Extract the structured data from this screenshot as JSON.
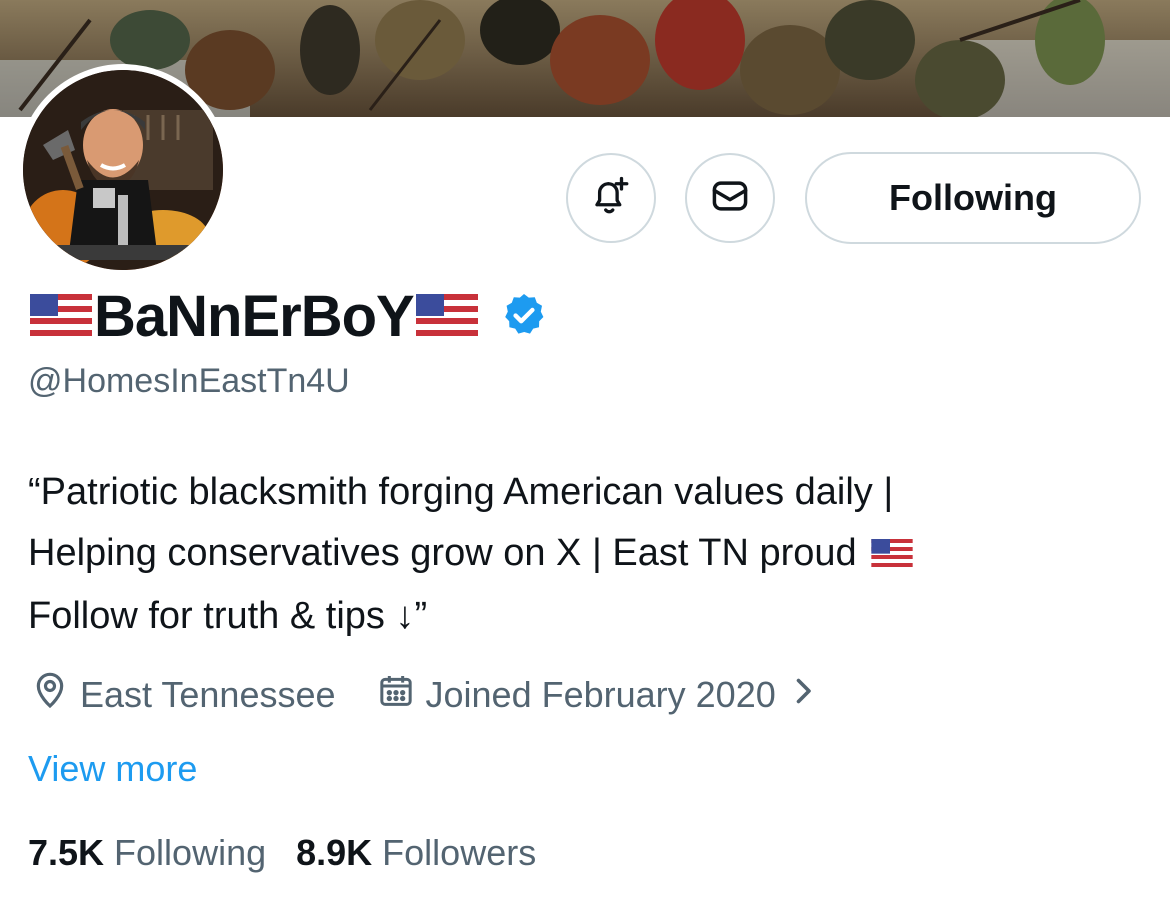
{
  "profile": {
    "display_name": "BaNnErBoY",
    "handle": "@HomesInEastTn4U",
    "verified_icon": "verified-badge-icon",
    "flag_icon": "us-flag-icon"
  },
  "actions": {
    "notify_icon": "bell-plus-icon",
    "message_icon": "envelope-icon",
    "follow_label": "Following"
  },
  "bio": {
    "line1": "“Patriotic blacksmith forging American values daily |",
    "line2": "Helping conservatives grow on X | East TN proud",
    "line3": "Follow for truth & tips ↓”"
  },
  "meta": {
    "location": "East Tennessee",
    "joined": "Joined February 2020",
    "location_icon": "location-pin-icon",
    "calendar_icon": "calendar-icon",
    "chevron_icon": "chevron-right-icon"
  },
  "view_more": "View more",
  "stats": {
    "following_count": "7.5K",
    "following_label": "Following",
    "followers_count": "8.9K",
    "followers_label": "Followers"
  },
  "colors": {
    "link": "#1d9bf0",
    "secondary_text": "#536471",
    "border": "#cfd9de",
    "primary_text": "#0f1419"
  }
}
